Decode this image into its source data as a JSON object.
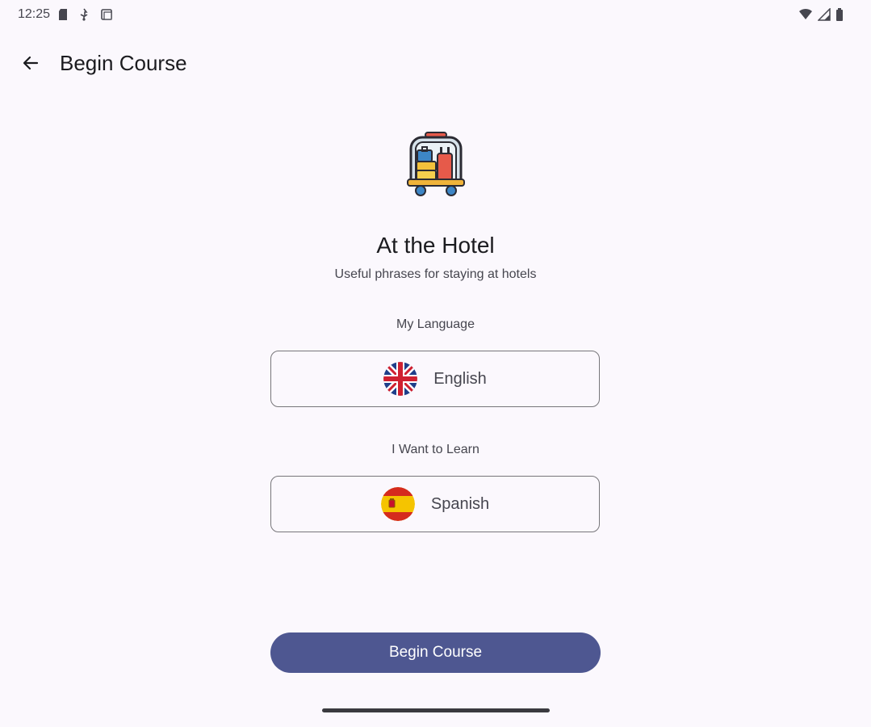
{
  "status_bar": {
    "time": "12:25",
    "left_icons": [
      "sd-card-icon",
      "usb-debug-icon",
      "screenshot-icon"
    ],
    "right_icons": [
      "wifi-icon",
      "cellular-signal-icon",
      "battery-icon"
    ]
  },
  "top_bar": {
    "title": "Begin Course",
    "back_icon": "arrow-back-icon"
  },
  "course": {
    "image_icon": "luggage-cart-icon",
    "title": "At the Hotel",
    "subtitle": "Useful phrases for staying at hotels"
  },
  "my_language": {
    "label": "My Language",
    "value": "English",
    "flag_icon": "uk-flag-icon"
  },
  "learn_language": {
    "label": "I Want to Learn",
    "value": "Spanish",
    "flag_icon": "spain-flag-icon"
  },
  "begin_button": {
    "label": "Begin Course"
  },
  "colors": {
    "background": "#fbf8fd",
    "primary": "#4e5791",
    "outline": "#77767a"
  }
}
